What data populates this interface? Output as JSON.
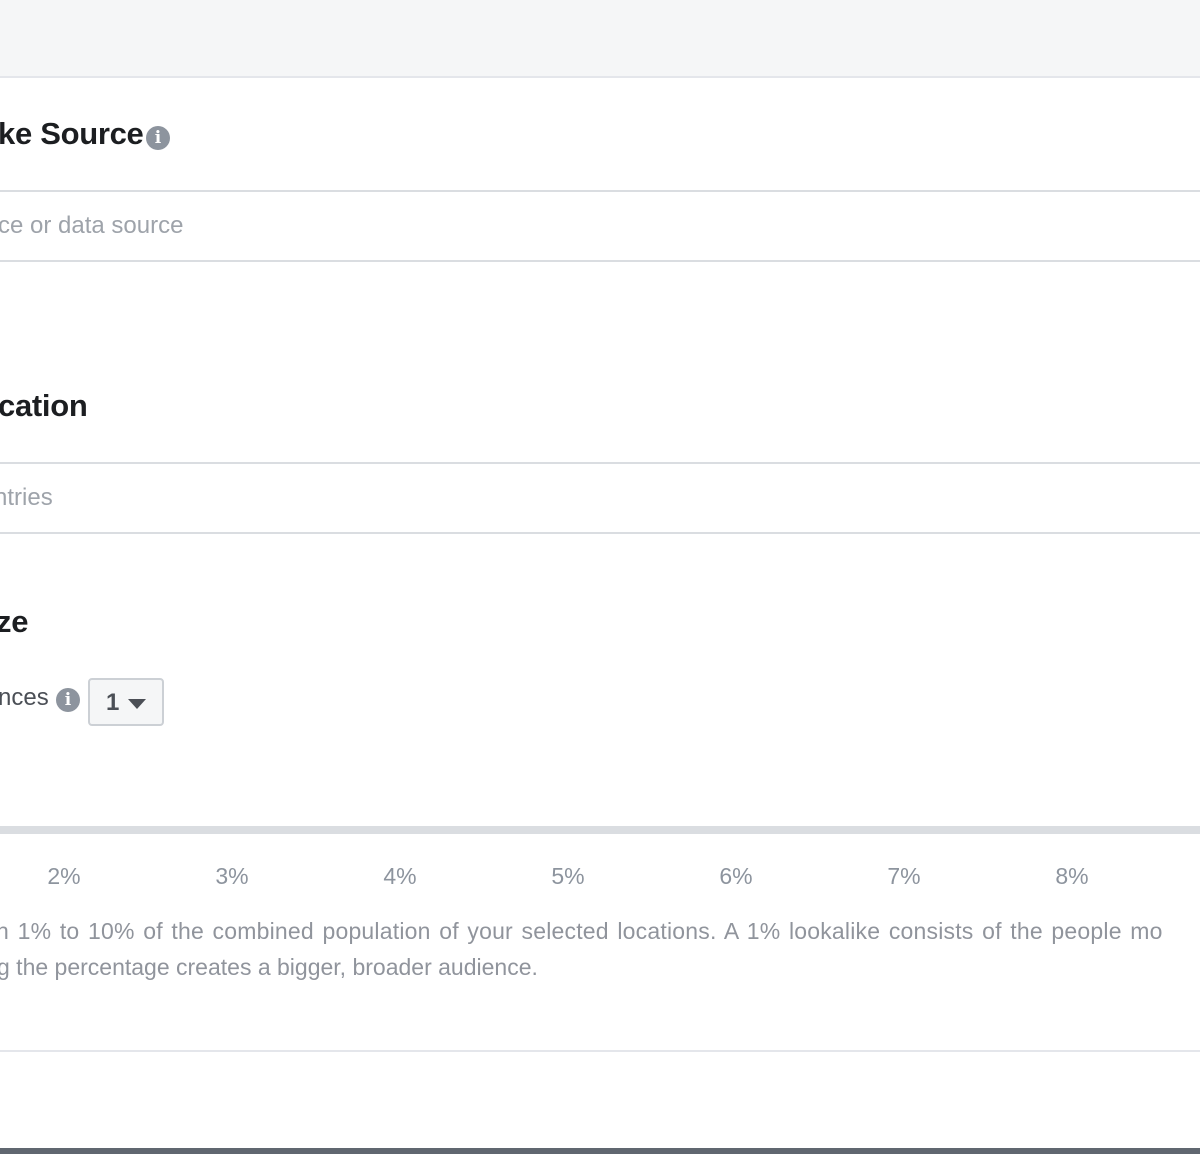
{
  "sections": {
    "source": {
      "heading": "ke Source",
      "input_placeholder": "ce or data source"
    },
    "location": {
      "heading": "cation",
      "input_placeholder": "ntries"
    },
    "size": {
      "heading": "ze",
      "instances_label": "nces",
      "instances_value": "1"
    }
  },
  "slider": {
    "ticks": [
      "2%",
      "3%",
      "4%",
      "5%",
      "6%",
      "7%",
      "8%"
    ]
  },
  "description": {
    "line1": "n 1% to 10% of the combined population of your selected locations. A 1% lookalike consists of the people mo",
    "line2": "g the percentage creates a bigger, broader audience."
  },
  "icons": {
    "info": "info-icon",
    "dropdown": "caret-down-icon"
  },
  "colors": {
    "heading": "#1c1e21",
    "muted_text": "#90949c",
    "icon_gray": "#8d949e",
    "border": "#dadde1",
    "top_bar_bg": "#f5f6f7"
  }
}
